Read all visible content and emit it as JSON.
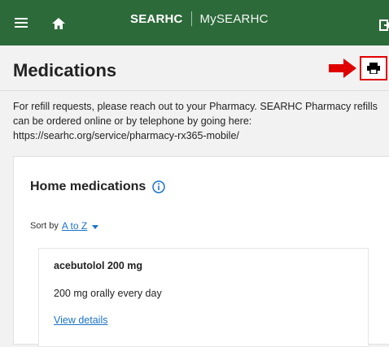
{
  "app": {
    "brand": "SEARHC",
    "product": "MySEARHC"
  },
  "page": {
    "title": "Medications",
    "intro_text": "For refill requests, please reach out to your Pharmacy. SEARHC Pharmacy refills can be ordered online or by telephone by going here: https://searhc.org/service/pharmacy-rx365-mobile/"
  },
  "section": {
    "title": "Home medications",
    "sort_label": "Sort by",
    "sort_value": "A to Z"
  },
  "medications": [
    {
      "name": "acebutolol 200 mg",
      "instructions": "200 mg orally every day",
      "details_link": "View details"
    }
  ],
  "colors": {
    "header_bg": "#2d6a3a",
    "link": "#1a73c8",
    "highlight_red": "#e00000"
  },
  "icons": {
    "menu": "hamburger-icon",
    "home": "home-icon",
    "logout": "logout-icon",
    "print": "print-icon",
    "info": "info-icon",
    "arrow": "arrow-right-icon"
  }
}
